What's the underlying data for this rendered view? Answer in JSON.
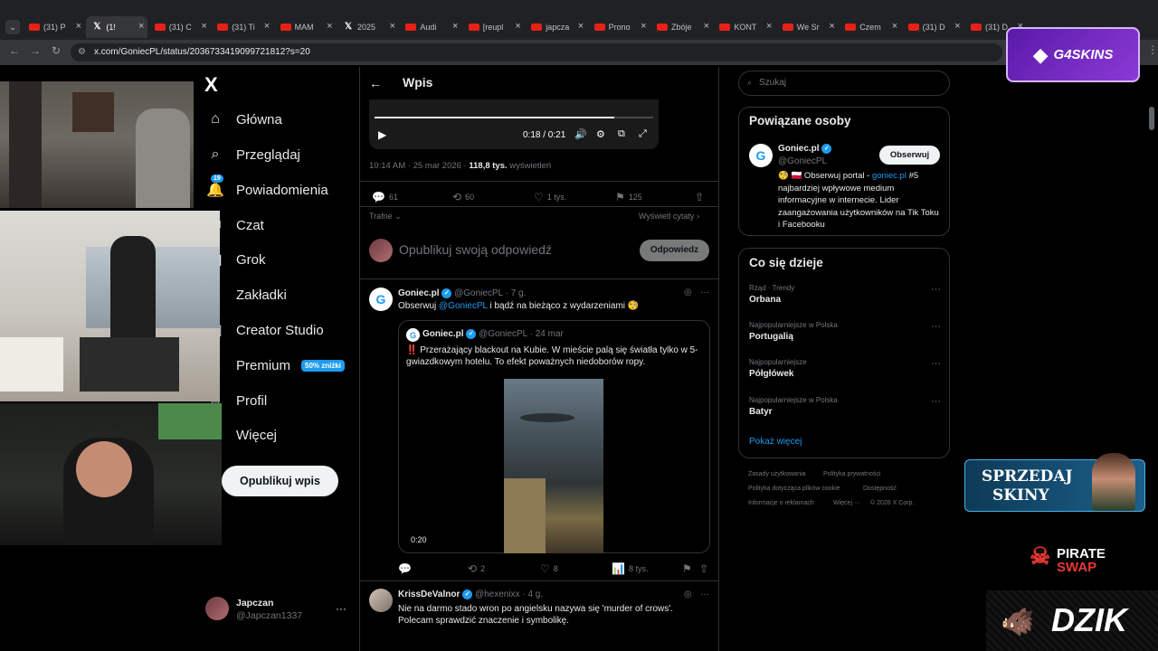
{
  "browser": {
    "tabs": [
      {
        "title": "(31) P",
        "icon": "youtube-icon"
      },
      {
        "title": "(1!",
        "icon": "x-icon",
        "active": true
      },
      {
        "title": "(31) C",
        "icon": "youtube-icon"
      },
      {
        "title": "(31) Ti",
        "icon": "youtube-icon"
      },
      {
        "title": "MAM",
        "icon": "youtube-icon"
      },
      {
        "title": "2025",
        "icon": "x-icon"
      },
      {
        "title": "Audi",
        "icon": "youtube-icon"
      },
      {
        "title": "[reupl",
        "icon": "youtube-icon"
      },
      {
        "title": "japcza",
        "icon": "youtube-icon"
      },
      {
        "title": "Prono",
        "icon": "youtube-icon"
      },
      {
        "title": "Zbóje",
        "icon": "youtube-icon"
      },
      {
        "title": "KONT",
        "icon": "youtube-icon"
      },
      {
        "title": "We Sr",
        "icon": "youtube-icon"
      },
      {
        "title": "Czem",
        "icon": "youtube-icon"
      },
      {
        "title": "(31) D",
        "icon": "youtube-icon"
      },
      {
        "title": "(31) D",
        "icon": "youtube-icon"
      }
    ],
    "url": "x.com/GoniecPL/status/2036733419099721812?s=20"
  },
  "overlays": {
    "g4skins": "G4SKINS",
    "sprzedaj_line1": "SPRZEDAJ",
    "sprzedaj_line2": "SKINY",
    "pirate_line1": "PIRATE",
    "pirate_line2": "SWAP",
    "dzik": "DZIK"
  },
  "nav": {
    "logo": "X",
    "items": [
      {
        "label": "Główna",
        "icon": "home-icon"
      },
      {
        "label": "Przeglądaj",
        "icon": "search-icon"
      },
      {
        "label": "Powiadomienia",
        "icon": "bell-icon",
        "badge": "19"
      },
      {
        "label": "Czat",
        "icon": "mail-icon"
      },
      {
        "label": "Grok",
        "icon": "grok-icon"
      },
      {
        "label": "Zakładki",
        "icon": "bookmark-icon"
      },
      {
        "label": "Creator Studio",
        "icon": "chart-icon"
      },
      {
        "label": "Premium",
        "icon": "x-premium-icon",
        "tag": "50% zniżki"
      },
      {
        "label": "Profil",
        "icon": "user-icon"
      },
      {
        "label": "Więcej",
        "icon": "more-circle-icon"
      }
    ],
    "post_button": "Opublikuj wpis",
    "account": {
      "name": "Japczan",
      "handle": "@Japczan1337"
    }
  },
  "main": {
    "header_title": "Wpis",
    "video": {
      "time": "0:18 / 0:21",
      "progress": 0.86
    },
    "post_meta": {
      "time": "10:14 AM · 25 mar 2026 · ",
      "views": "118,8 tys.",
      "views_label": " wyświetleń"
    },
    "stats": {
      "replies": "61",
      "reposts": "60",
      "likes": "1 tys.",
      "bookmarks": "125"
    },
    "sort_label": "Trafne",
    "quotes_label": "Wyświetl cytaty",
    "reply_placeholder": "Opublikuj swoją odpowiedź",
    "reply_button": "Odpowiedz",
    "reply1": {
      "name": "Goniec.pl",
      "handle": "@GoniecPL",
      "time": "· 7 g.",
      "text_pre": "Obserwuj ",
      "mention": "@GoniecPL",
      "text_post": " i bądź na bieżąco z wydarzeniami 🧐",
      "quote": {
        "name": "Goniec.pl",
        "handle": "@GoniecPL",
        "time": "· 24 mar",
        "text": "‼️ Przerażający blackout na Kubie. W mieście palą się światła tylko w 5-gwiazdkowym hotelu. To efekt poważnych niedoborów ropy.",
        "video_time": "0:20"
      },
      "stats": {
        "reposts": "2",
        "likes": "8",
        "views": "8 tys."
      }
    },
    "reply2": {
      "name": "KrissDeValnor",
      "handle": "@hexenixx",
      "time": "· 4 g.",
      "text": "Nie na darmo stado wron po angielsku nazywa się 'murder of crows'. Polecam sprawdzić znaczenie i symbolikę."
    }
  },
  "sidebar": {
    "search_placeholder": "Szukaj",
    "related": {
      "title": "Powiązane osoby",
      "name": "Goniec.pl",
      "handle": "@GoniecPL",
      "follow": "Obserwuj",
      "bio_pre": "🧐 🇵🇱 Obserwuj portal - ",
      "bio_link": "goniec.pl",
      "bio_post": " #5 najbardziej wpływowe medium informacyjne w internecie. Lider zaangażowania użytkowników na Tik Toku i Facebooku"
    },
    "trends": {
      "title": "Co się dzieje",
      "items": [
        {
          "category": "Rząd · Trendy",
          "name": "Orbana"
        },
        {
          "category": "Najpopularniejsze w Polska",
          "name": "Portugalią"
        },
        {
          "category": "Najpopularniejsze",
          "name": "Półgłówek"
        },
        {
          "category": "Najpopularniejsze w Polska",
          "name": "Batyr"
        }
      ],
      "show_more": "Pokaż więcej"
    },
    "footer": {
      "l1": "Zasady użytkowania",
      "l2": "Polityka prywatności",
      "l3": "Polityka dotycząca plików cookie",
      "l4": "Dostępność",
      "l5": "Informacje o reklamach",
      "l6": "Więcej ···",
      "l7": "© 2026 X Corp."
    }
  }
}
